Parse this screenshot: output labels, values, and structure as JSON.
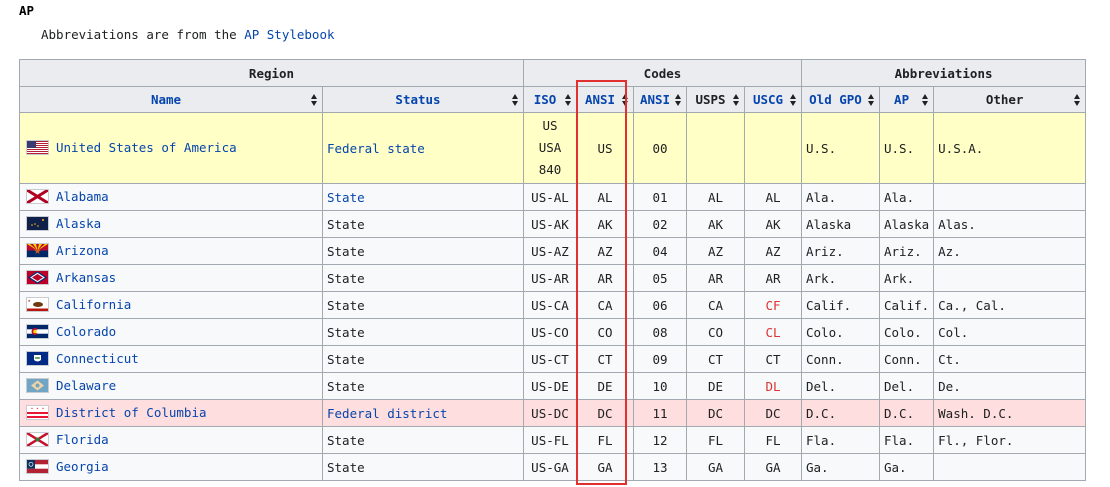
{
  "heading": "AP",
  "intro": {
    "prefix": "Abbreviations are from the ",
    "link": "AP Stylebook"
  },
  "groups": {
    "region": "Region",
    "codes": "Codes",
    "abbreviations": "Abbreviations"
  },
  "columns": {
    "name": "Name",
    "status": "Status",
    "iso": "ISO",
    "ansi_a": "ANSI",
    "ansi_n": "ANSI",
    "usps": "USPS",
    "uscg": "USCG",
    "gpo": "Old GPO",
    "ap": "AP",
    "other": "Other"
  },
  "nation": {
    "name": "United States of America",
    "status": "Federal state",
    "iso": [
      "US",
      "USA",
      "840"
    ],
    "ansi_a": "US",
    "ansi_n": "00",
    "usps": "",
    "uscg": "",
    "gpo": "U.S.",
    "ap": "U.S.",
    "other": "U.S.A.",
    "flag": "us-flag-icon"
  },
  "rows": [
    {
      "name": "Alabama",
      "status": "State",
      "status_link": true,
      "iso": "US-AL",
      "ansi_a": "AL",
      "ansi_n": "01",
      "usps": "AL",
      "uscg": "AL",
      "uscg_red": false,
      "gpo": "Ala.",
      "ap": "Ala.",
      "other": "",
      "flag": "alabama-flag-icon"
    },
    {
      "name": "Alaska",
      "status": "State",
      "status_link": false,
      "iso": "US-AK",
      "ansi_a": "AK",
      "ansi_n": "02",
      "usps": "AK",
      "uscg": "AK",
      "uscg_red": false,
      "gpo": "Alaska",
      "ap": "Alaska",
      "other": "Alas.",
      "flag": "alaska-flag-icon"
    },
    {
      "name": "Arizona",
      "status": "State",
      "status_link": false,
      "iso": "US-AZ",
      "ansi_a": "AZ",
      "ansi_n": "04",
      "usps": "AZ",
      "uscg": "AZ",
      "uscg_red": false,
      "gpo": "Ariz.",
      "ap": "Ariz.",
      "other": "Az.",
      "flag": "arizona-flag-icon"
    },
    {
      "name": "Arkansas",
      "status": "State",
      "status_link": false,
      "iso": "US-AR",
      "ansi_a": "AR",
      "ansi_n": "05",
      "usps": "AR",
      "uscg": "AR",
      "uscg_red": false,
      "gpo": "Ark.",
      "ap": "Ark.",
      "other": "",
      "flag": "arkansas-flag-icon"
    },
    {
      "name": "California",
      "status": "State",
      "status_link": false,
      "iso": "US-CA",
      "ansi_a": "CA",
      "ansi_n": "06",
      "usps": "CA",
      "uscg": "CF",
      "uscg_red": true,
      "gpo": "Calif.",
      "ap": "Calif.",
      "other": "Ca., Cal.",
      "flag": "california-flag-icon"
    },
    {
      "name": "Colorado",
      "status": "State",
      "status_link": false,
      "iso": "US-CO",
      "ansi_a": "CO",
      "ansi_n": "08",
      "usps": "CO",
      "uscg": "CL",
      "uscg_red": true,
      "gpo": "Colo.",
      "ap": "Colo.",
      "other": "Col.",
      "flag": "colorado-flag-icon"
    },
    {
      "name": "Connecticut",
      "status": "State",
      "status_link": false,
      "iso": "US-CT",
      "ansi_a": "CT",
      "ansi_n": "09",
      "usps": "CT",
      "uscg": "CT",
      "uscg_red": false,
      "gpo": "Conn.",
      "ap": "Conn.",
      "other": "Ct.",
      "flag": "connecticut-flag-icon"
    },
    {
      "name": "Delaware",
      "status": "State",
      "status_link": false,
      "iso": "US-DE",
      "ansi_a": "DE",
      "ansi_n": "10",
      "usps": "DE",
      "uscg": "DL",
      "uscg_red": true,
      "gpo": "Del.",
      "ap": "Del.",
      "other": "De.",
      "flag": "delaware-flag-icon"
    },
    {
      "name": "District of Columbia",
      "status": "Federal district",
      "status_link": true,
      "district": true,
      "iso": "US-DC",
      "ansi_a": "DC",
      "ansi_n": "11",
      "usps": "DC",
      "uscg": "DC",
      "uscg_red": false,
      "gpo": "D.C.",
      "ap": "D.C.",
      "other": "Wash. D.C.",
      "flag": "dc-flag-icon"
    },
    {
      "name": "Florida",
      "status": "State",
      "status_link": false,
      "iso": "US-FL",
      "ansi_a": "FL",
      "ansi_n": "12",
      "usps": "FL",
      "uscg": "FL",
      "uscg_red": false,
      "gpo": "Fla.",
      "ap": "Fla.",
      "other": "Fl., Flor.",
      "flag": "florida-flag-icon"
    },
    {
      "name": "Georgia",
      "status": "State",
      "status_link": false,
      "iso": "US-GA",
      "ansi_a": "GA",
      "ansi_n": "13",
      "usps": "GA",
      "uscg": "GA",
      "uscg_red": false,
      "gpo": "Ga.",
      "ap": "Ga.",
      "other": "",
      "flag": "georgia-flag-icon"
    }
  ],
  "colors": {
    "link": "#0645ad",
    "header_bg": "#eaecf0",
    "nation_bg": "#ffffc6",
    "district_bg": "#fedede",
    "red_text": "#dd3333",
    "highlight_box": "#e03030"
  }
}
